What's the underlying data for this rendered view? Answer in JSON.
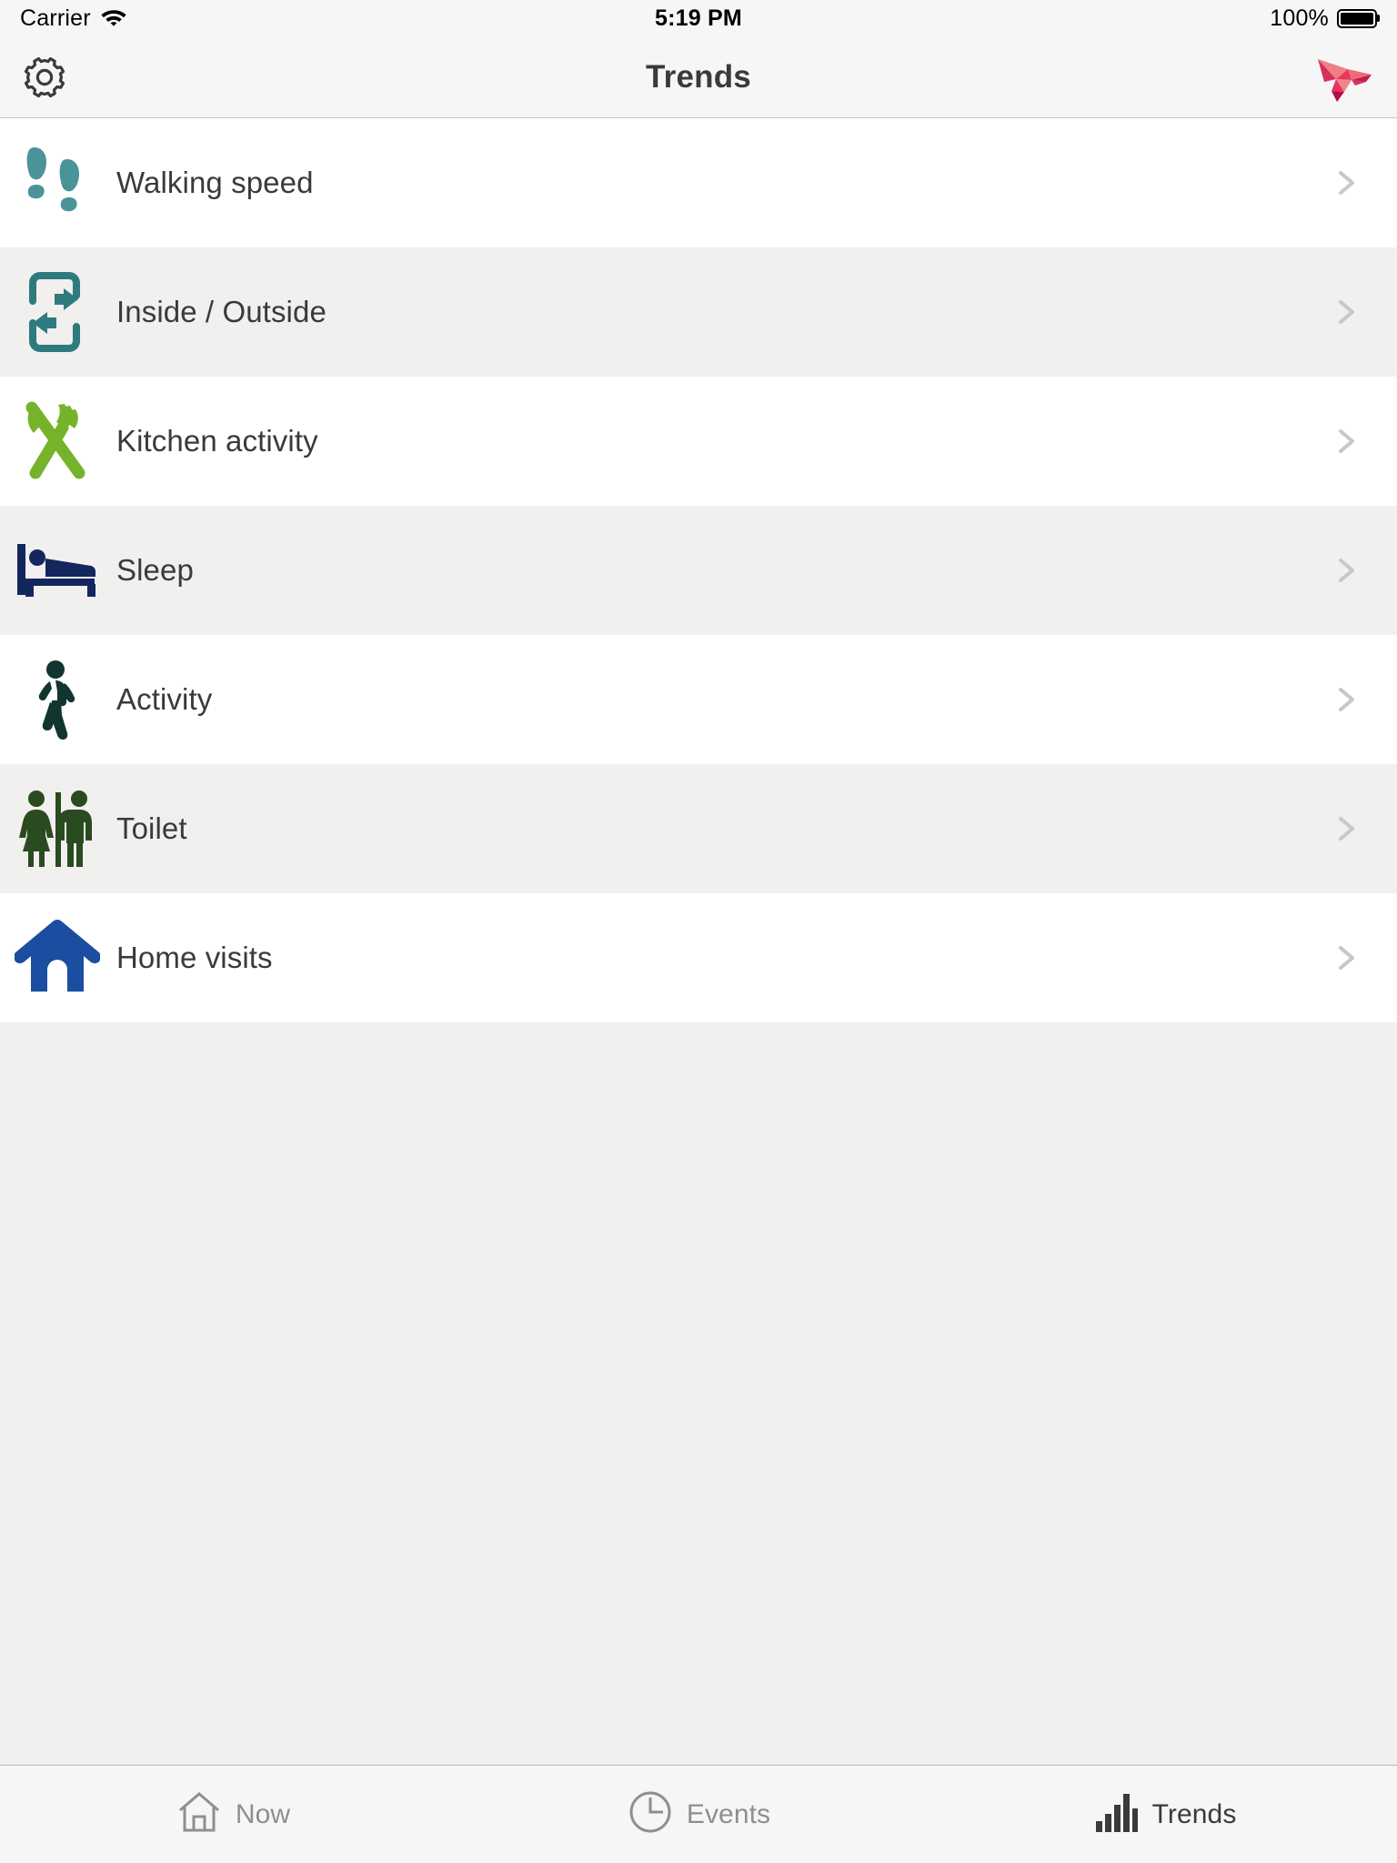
{
  "statusbar": {
    "carrier": "Carrier",
    "wifi_icon": "wifi-icon",
    "time": "5:19 PM",
    "battery_percent": "100%",
    "battery_icon": "battery-full-icon"
  },
  "navbar": {
    "title": "Trends",
    "settings_icon": "gear-icon",
    "logo_icon": "origami-bird-logo"
  },
  "list": {
    "rows": [
      {
        "label": "Walking speed",
        "icon": "footprints-icon",
        "color": "#4a9499",
        "chevron": "chevron-right-icon"
      },
      {
        "label": "Inside / Outside",
        "icon": "door-inout-icon",
        "color": "#2f7a7d",
        "chevron": "chevron-right-icon"
      },
      {
        "label": "Kitchen activity",
        "icon": "fork-knife-icon",
        "color": "#76b32b",
        "chevron": "chevron-right-icon"
      },
      {
        "label": "Sleep",
        "icon": "bed-icon",
        "color": "#13265e",
        "chevron": "chevron-right-icon"
      },
      {
        "label": "Activity",
        "icon": "walking-person-icon",
        "color": "#12352f",
        "chevron": "chevron-right-icon"
      },
      {
        "label": "Toilet",
        "icon": "restroom-icon",
        "color": "#2a4a20",
        "chevron": "chevron-right-icon"
      },
      {
        "label": "Home visits",
        "icon": "house-icon",
        "color": "#1b4da0",
        "chevron": "chevron-right-icon"
      }
    ]
  },
  "tabbar": {
    "tabs": [
      {
        "label": "Now",
        "icon": "house-outline-icon",
        "active": false
      },
      {
        "label": "Events",
        "icon": "clock-outline-icon",
        "active": false
      },
      {
        "label": "Trends",
        "icon": "bar-chart-icon",
        "active": true
      }
    ]
  },
  "colors": {
    "row_bg_light": "#ffffff",
    "row_bg_alt": "#f2efef",
    "chrome_bg": "#f7f6f7",
    "text_primary": "#3a3a3c",
    "text_muted": "#8e8e93",
    "chevron": "#c7c7cc",
    "logo_pink": "#e8365f",
    "logo_salmon": "#ef6a72"
  }
}
